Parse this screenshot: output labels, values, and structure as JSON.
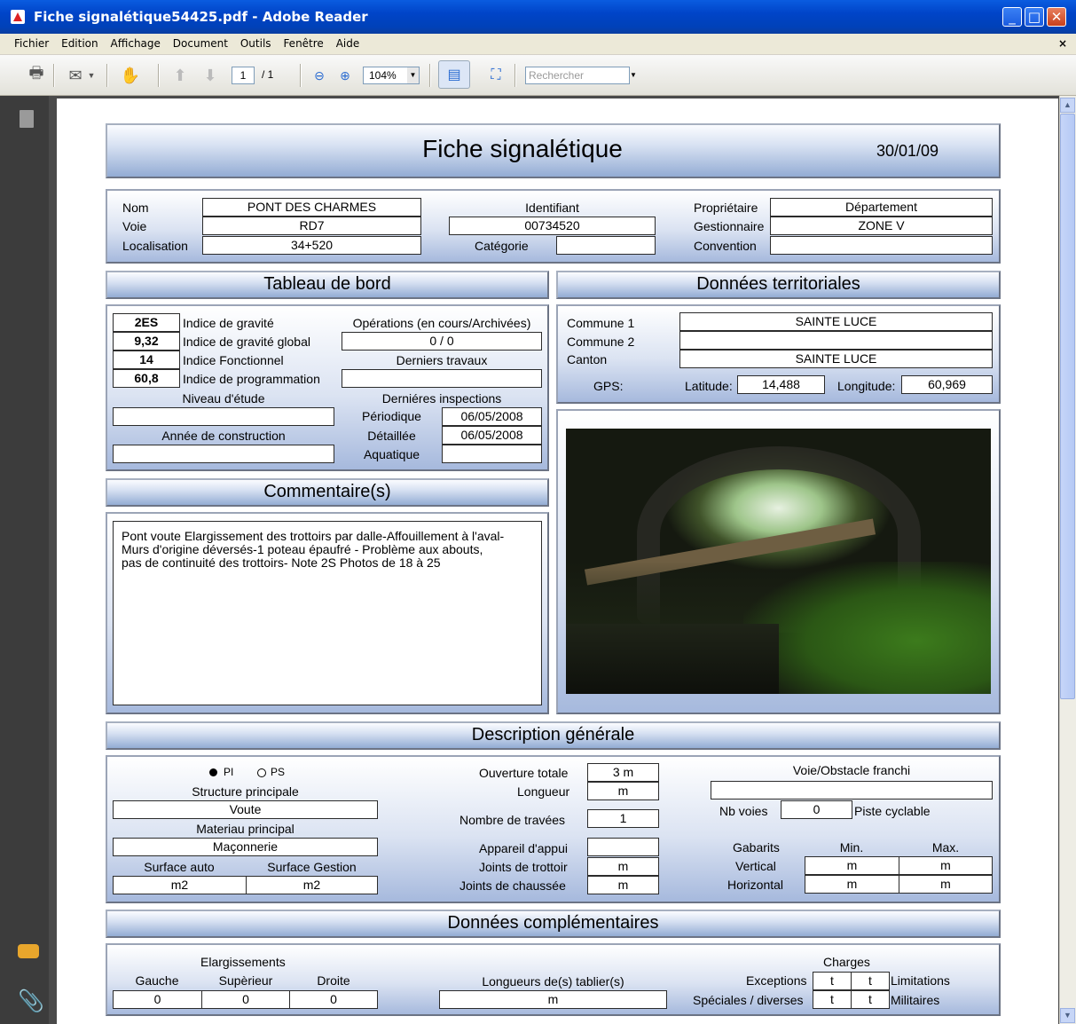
{
  "window": {
    "title": "Fiche signalétique54425.pdf - Adobe Reader",
    "min": "_",
    "max": "□",
    "close": "✕"
  },
  "menu": [
    "Fichier",
    "Edition",
    "Affichage",
    "Document",
    "Outils",
    "Fenêtre",
    "Aide"
  ],
  "menu_close": "×",
  "toolbar": {
    "page_current": "1",
    "page_total": "/ 1",
    "zoom": "104%",
    "search_placeholder": "Rechercher"
  },
  "doc": {
    "title": "Fiche signalétique",
    "date": "30/01/09",
    "ident": {
      "nom_label": "Nom",
      "nom": "PONT DES CHARMES",
      "voie_label": "Voie",
      "voie": "RD7",
      "localisation_label": "Localisation",
      "localisation": "34+520",
      "identifiant_label": "Identifiant",
      "identifiant": "00734520",
      "categorie_label": "Catégorie",
      "categorie": "",
      "proprietaire_label": "Propriétaire",
      "proprietaire": "Département",
      "gestionnaire_label": "Gestionnaire",
      "gestionnaire": "ZONE V",
      "convention_label": "Convention",
      "convention": ""
    },
    "tableau": {
      "header": "Tableau de bord",
      "indices": [
        {
          "value": "2ES",
          "label": "Indice de gravité"
        },
        {
          "value": "9,32",
          "label": "Indice de gravité global"
        },
        {
          "value": "14",
          "label": "Indice Fonctionnel"
        },
        {
          "value": "60,8",
          "label": "Indice de programmation"
        }
      ],
      "operations_label": "Opérations (en cours/Archivées)",
      "operations": "0 / 0",
      "derniers_travaux_label": "Derniers travaux",
      "derniers_travaux": "",
      "niveau_label": "Niveau d'étude",
      "niveau": "",
      "annee_label": "Année de construction",
      "annee": "",
      "inspections_label": "Derniéres inspections",
      "periodique_label": "Périodique",
      "periodique": "06/05/2008",
      "detaillee_label": "Détaillée",
      "detaillee": "06/05/2008",
      "aquatique_label": "Aquatique",
      "aquatique": ""
    },
    "territoriales": {
      "header": "Données territoriales",
      "commune1_label": "Commune 1",
      "commune1": "SAINTE LUCE",
      "commune2_label": "Commune 2",
      "commune2": "",
      "canton_label": "Canton",
      "canton": "SAINTE LUCE",
      "gps_label": "GPS:",
      "latitude_label": "Latitude:",
      "latitude": "14,488",
      "longitude_label": "Longitude:",
      "longitude": "60,969"
    },
    "commentaire": {
      "header": "Commentaire(s)",
      "lines": [
        "Pont voute Elargissement des trottoirs par dalle-Affouillement à l'aval-",
        "Murs d'origine déversés-1 poteau épaufré - Problème aux abouts,",
        "pas de continuité des trottoirs- Note 2S Photos de 18 à 25"
      ]
    },
    "description": {
      "header": "Description générale",
      "pi_label": "PI",
      "ps_label": "PS",
      "structure_label": "Structure principale",
      "structure": "Voute",
      "materiau_label": "Materiau principal",
      "materiau": "Maçonnerie",
      "surface_auto_label": "Surface auto",
      "surface_auto": "m2",
      "surface_gestion_label": "Surface Gestion",
      "surface_gestion": "m2",
      "ouverture_label": "Ouverture totale",
      "ouverture": "3 m",
      "longueur_label": "Longueur",
      "longueur": "m",
      "travees_label": "Nombre de travées",
      "travees": "1",
      "appareil_label": "Appareil d'appui",
      "appareil": "",
      "joints_trottoir_label": "Joints de trottoir",
      "joints_trottoir": "m",
      "joints_chaussee_label": "Joints de chaussée",
      "joints_chaussee": "m",
      "voie_obstacle_label": "Voie/Obstacle franchi",
      "voie_obstacle": "",
      "nb_voies_label": "Nb voies",
      "nb_voies": "0",
      "piste_label": "Piste cyclable",
      "gabarits_label": "Gabarits",
      "min_label": "Min.",
      "max_label": "Max.",
      "vertical_label": "Vertical",
      "vertical_min": "m",
      "vertical_max": "m",
      "horizontal_label": "Horizontal",
      "horizontal_min": "m",
      "horizontal_max": "m"
    },
    "complementaires": {
      "header": "Données complémentaires",
      "elargissements_label": "Elargissements",
      "gauche_label": "Gauche",
      "gauche": "0",
      "superieur_label": "Supèrieur",
      "superieur": "0",
      "droite_label": "Droite",
      "droite": "0",
      "longueurs_label": "Longueurs de(s) tablier(s)",
      "longueurs": "m",
      "charges_label": "Charges",
      "exceptions_label": "Exceptions",
      "exc_t1": "t",
      "exc_t2": "t",
      "limitations_label": "Limitations",
      "speciales_label": "Spéciales / diverses",
      "spe_t1": "t",
      "spe_t2": "t",
      "militaires_label": "Militaires"
    }
  },
  "colors": {
    "titlebar": "#0044c8",
    "panel_gradient": "#a6b9dd",
    "dark_panel": "#3c3c3c"
  }
}
